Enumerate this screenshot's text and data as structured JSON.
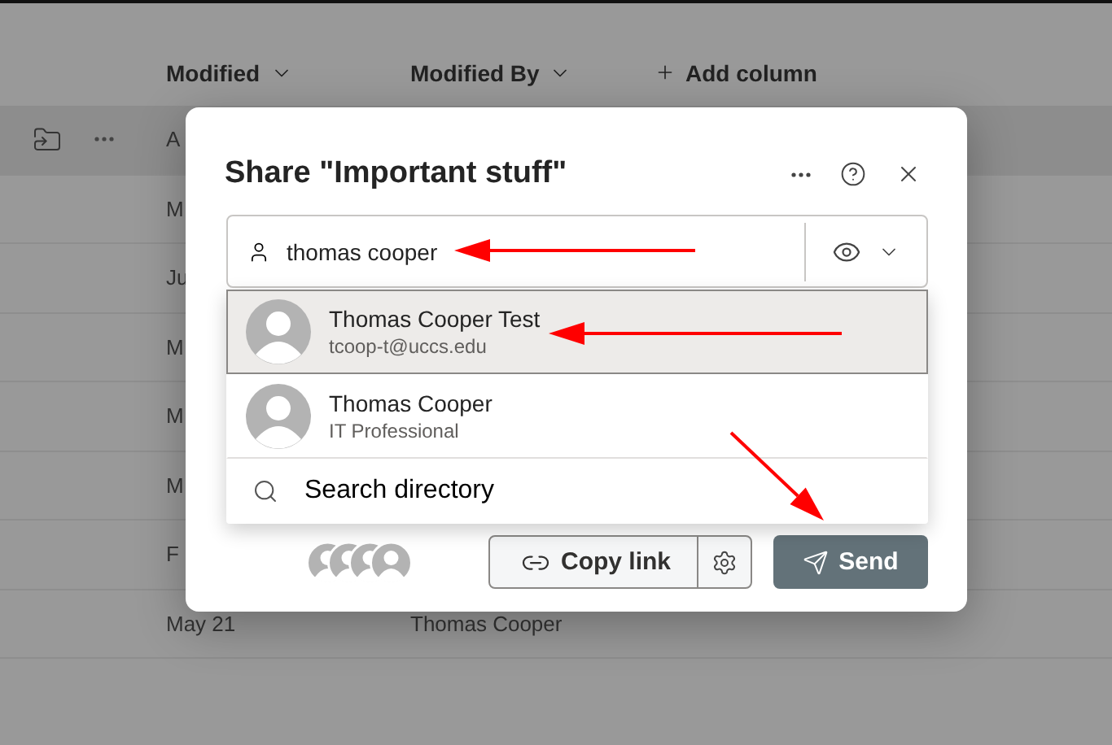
{
  "list": {
    "columns": [
      {
        "label": "Modified",
        "kind": "sort"
      },
      {
        "label": "Modified By",
        "kind": "sort"
      },
      {
        "label": "Add column",
        "kind": "add"
      }
    ],
    "rows": [
      {
        "modified": "A",
        "selected": true
      },
      {
        "modified": "M",
        "selected": false
      },
      {
        "modified": "Ju",
        "selected": false
      },
      {
        "modified": "M",
        "selected": false
      },
      {
        "modified": "M",
        "selected": false
      },
      {
        "modified": "M",
        "selected": false
      },
      {
        "modified": "F",
        "selected": false
      },
      {
        "modified": "May 21",
        "modified_by": "Thomas Cooper",
        "selected": false
      }
    ]
  },
  "dialog": {
    "title": "Share \"Important stuff\"",
    "search": {
      "value": "thomas cooper"
    },
    "suggestions": [
      {
        "name": "Thomas Cooper Test",
        "detail": "tcoop-t@uccs.edu",
        "selected": true
      },
      {
        "name": "Thomas Cooper",
        "detail": "IT Professional",
        "selected": false
      }
    ],
    "search_directory": "Search directory",
    "copy_link": "Copy link",
    "send": "Send"
  }
}
